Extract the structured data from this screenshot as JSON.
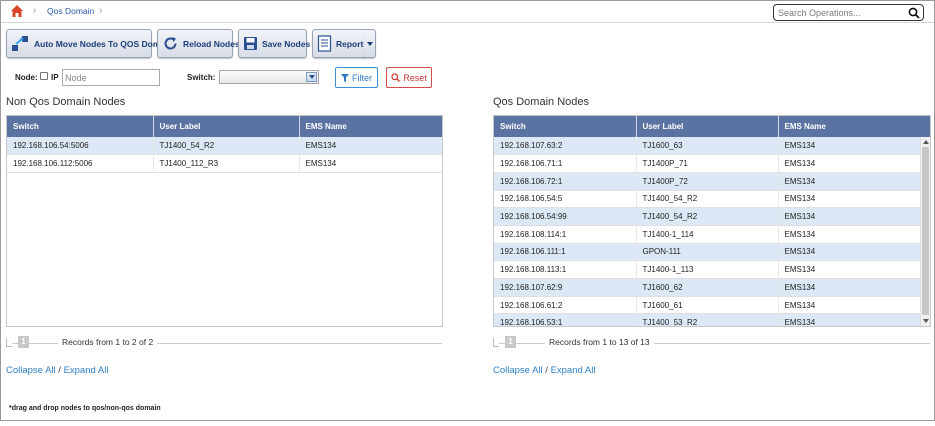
{
  "breadcrumb": {
    "current": "Qos Domain"
  },
  "search": {
    "placeholder": "Search Operations..."
  },
  "toolbar": {
    "auto_move_label": "Auto Move Nodes To QOS Domain",
    "reload_label": "Reload Nodes",
    "save_label": "Save Nodes",
    "reports_label": "Reports"
  },
  "filter": {
    "node_label": "Node:",
    "ip_label": "IP",
    "node_placeholder": "Node",
    "switch_label": "Switch:",
    "switch_value": "",
    "filter_label": "Filter",
    "reset_label": "Reset"
  },
  "non_qos": {
    "title": "Non Qos Domain Nodes",
    "columns": [
      "Switch",
      "User Label",
      "EMS Name"
    ],
    "rows": [
      [
        "192.168.106.54:5006",
        "TJ1400_54_R2",
        "EMS134"
      ],
      [
        "192.168.106.112:5006",
        "TJ1400_112_R3",
        "EMS134"
      ]
    ],
    "page": "1",
    "records_text": "Records from 1 to 2 of 2"
  },
  "qos": {
    "title": "Qos Domain Nodes",
    "columns": [
      "Switch",
      "User Label",
      "EMS Name"
    ],
    "rows": [
      [
        "192.168.107.63:2",
        "TJ1600_63",
        "EMS134"
      ],
      [
        "192.168.106.71:1",
        "TJ1400P_71",
        "EMS134"
      ],
      [
        "192.168.106.72:1",
        "TJ1400P_72",
        "EMS134"
      ],
      [
        "192.168.106.54:5",
        "TJ1400_54_R2",
        "EMS134"
      ],
      [
        "192.168.106.54:99",
        "TJ1400_54_R2",
        "EMS134"
      ],
      [
        "192.168.108.114:1",
        "TJ1400-1_114",
        "EMS134"
      ],
      [
        "192.168.106.111:1",
        "GPON-111",
        "EMS134"
      ],
      [
        "192.168.108.113:1",
        "TJ1400-1_113",
        "EMS134"
      ],
      [
        "192.168.107.62:9",
        "TJ1600_62",
        "EMS134"
      ],
      [
        "192.168.106.61:2",
        "TJ1600_61",
        "EMS134"
      ],
      [
        "192.168.106.53:1",
        "TJ1400_53_R2",
        "EMS134"
      ]
    ],
    "page": "1",
    "records_text": "Records from 1 to 13 of 13"
  },
  "links": {
    "collapse_all": "Collapse All",
    "separator": "/",
    "expand_all": "Expand All"
  },
  "footnote": "*drag and drop nodes to qos/non-qos domain",
  "colors": {
    "header_bg": "#5b73a2",
    "row_alt": "#dce8f6",
    "link": "#2f7fc5",
    "filter_btn": "#2d7ac6",
    "reset_btn": "#c93a3a"
  }
}
